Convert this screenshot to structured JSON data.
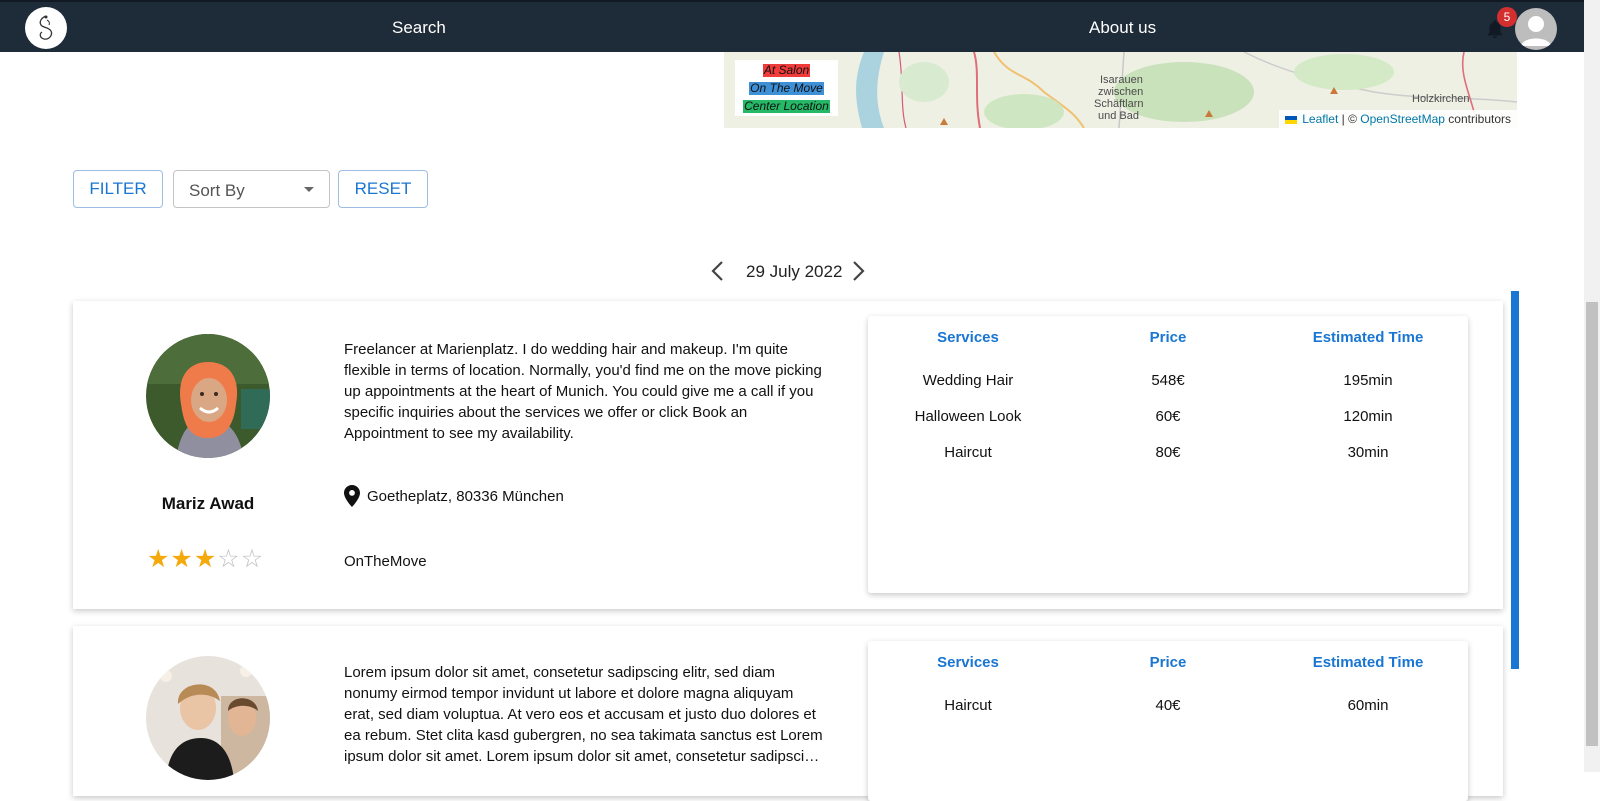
{
  "nav": {
    "search_label": "Search",
    "about_label": "About us",
    "notification_count": "5"
  },
  "map": {
    "legend": {
      "at_salon": "At Salon",
      "on_the_move": "On The Move",
      "center_location": "Center Location"
    },
    "labels": {
      "isarauen": "Isarauen",
      "zwischen": "zwischen",
      "schaftlarn": "Schäftlarn",
      "und_bad": "und Bad",
      "holzkirchen": "Holzkirchen"
    },
    "attribution": {
      "leaflet": "Leaflet",
      "separator": " | © ",
      "osm": "OpenStreetMap",
      "contributors": " contributors"
    },
    "colors": {
      "at_salon": "#f03b3b",
      "on_the_move": "#3d8fd6",
      "center_location": "#25b866"
    }
  },
  "controls": {
    "filter_label": "FILTER",
    "sort_placeholder": "Sort By",
    "reset_label": "RESET"
  },
  "date_pager": {
    "date": "29 July 2022"
  },
  "services_headers": {
    "services": "Services",
    "price": "Price",
    "estimated_time": "Estimated Time"
  },
  "providers": [
    {
      "name": "Mariz Awad",
      "rating": 3,
      "rating_max": 5,
      "description": "Freelancer at Marienplatz. I do wedding hair and makeup. I'm quite flexible in terms of location. Normally, you'd find me on the move picking up appointments at the heart of Munich. You could give me a call if you specific inquiries about the services we offer or click Book an Appointment to see my availability.",
      "location": "Goetheplatz, 80336 München",
      "mode": "OnTheMove",
      "services": [
        {
          "service": "Wedding Hair",
          "price": "548€",
          "time": "195min"
        },
        {
          "service": "Halloween Look",
          "price": "60€",
          "time": "120min"
        },
        {
          "service": "Haircut",
          "price": "80€",
          "time": "30min"
        }
      ]
    },
    {
      "description": "Lorem ipsum dolor sit amet, consetetur sadipscing elitr, sed diam nonumy eirmod tempor invidunt ut labore et dolore magna aliquyam erat, sed diam voluptua. At vero eos et accusam et justo duo dolores et ea rebum. Stet clita kasd gubergren, no sea takimata sanctus est Lorem ipsum dolor sit amet. Lorem ipsum dolor sit amet, consetetur sadipsci…",
      "services": [
        {
          "service": "Haircut",
          "price": "40€",
          "time": "60min"
        }
      ]
    }
  ],
  "theme": {
    "nav_bg": "#1e2b38",
    "accent": "#1976d2",
    "star": "#f4a90d",
    "badge": "#d32f2f"
  }
}
